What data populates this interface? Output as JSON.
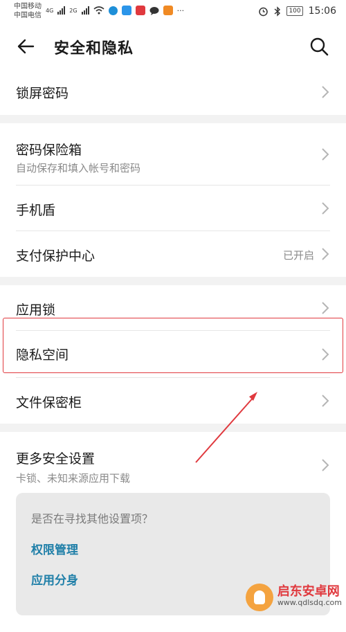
{
  "status_bar": {
    "carrier1": "中国移动",
    "carrier2": "中国电信",
    "net1": "4G",
    "net2": "2G",
    "more": "···",
    "battery": "100",
    "time": "15:06"
  },
  "header": {
    "title": "安全和隐私"
  },
  "rows": {
    "lock_screen": {
      "label": "锁屏密码"
    },
    "password_vault": {
      "label": "密码保险箱",
      "sub": "自动保存和填入帐号和密码"
    },
    "phone_shield": {
      "label": "手机盾"
    },
    "payment_protect": {
      "label": "支付保护中心",
      "value": "已开启"
    },
    "app_lock": {
      "label": "应用锁"
    },
    "private_space": {
      "label": "隐私空间"
    },
    "file_safe": {
      "label": "文件保密柜"
    },
    "more_security": {
      "label": "更多安全设置",
      "sub": "卡锁、未知来源应用下载"
    }
  },
  "suggest": {
    "question": "是否在寻找其他设置项？",
    "link1": "权限管理",
    "link2": "应用分身"
  },
  "watermark": {
    "name": "启东安卓网",
    "url": "www.qdlsdq.com"
  },
  "colors": {
    "accent_link": "#1f7fa8",
    "highlight": "#e0393e"
  }
}
